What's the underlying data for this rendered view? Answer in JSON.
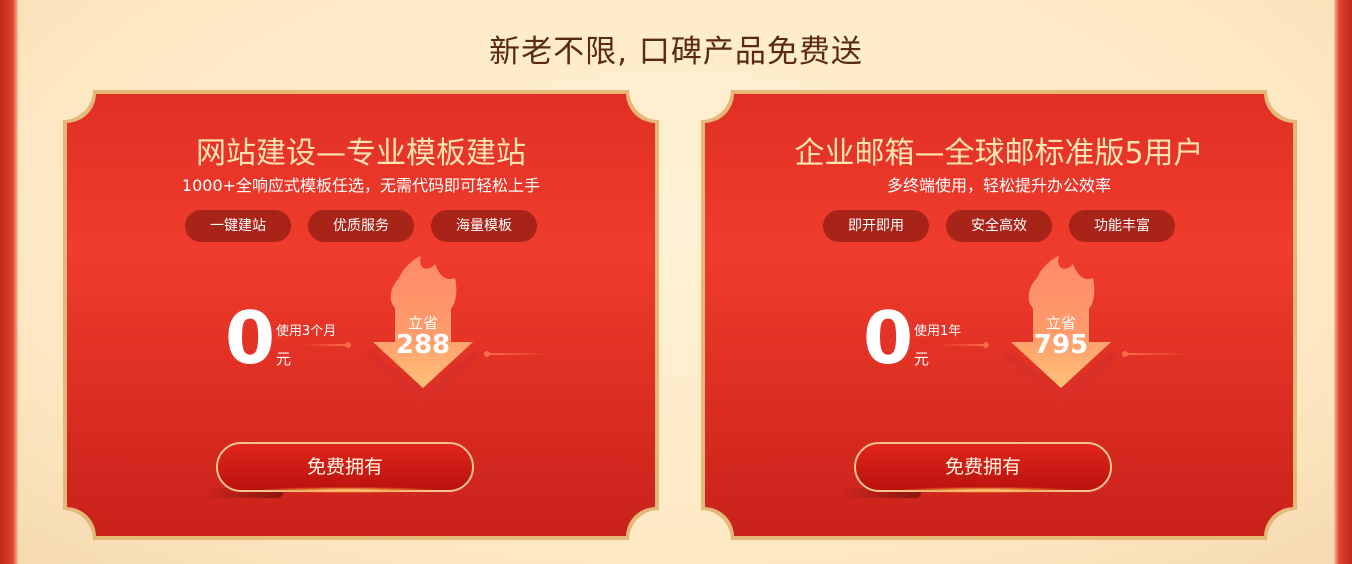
{
  "heading": "新老不限, 口碑产品免费送",
  "colors": {
    "card_red": "#e8352a",
    "card_border": "#e6b877",
    "tag_bg": "#a82318",
    "title_gold": "#ffe4b2",
    "heading_brown": "#5a2a12"
  },
  "cards": [
    {
      "title": "网站建设—专业模板建站",
      "subtitle": "1000+全响应式模板任选，无需代码即可轻松上手",
      "tags": [
        "一键建站",
        "优质服务",
        "海量模板"
      ],
      "price": "0",
      "price_desc": "使用3个月",
      "price_unit": "元",
      "save_label": "立省",
      "save_amount": "288",
      "button": "免费拥有",
      "icon": "fire-arrow-icon"
    },
    {
      "title": "企业邮箱—全球邮标准版5用户",
      "subtitle": "多终端使用，轻松提升办公效率",
      "tags": [
        "即开即用",
        "安全高效",
        "功能丰富"
      ],
      "price": "0",
      "price_desc": "使用1年",
      "price_unit": "元",
      "save_label": "立省",
      "save_amount": "795",
      "button": "免费拥有",
      "icon": "fire-arrow-icon"
    }
  ]
}
